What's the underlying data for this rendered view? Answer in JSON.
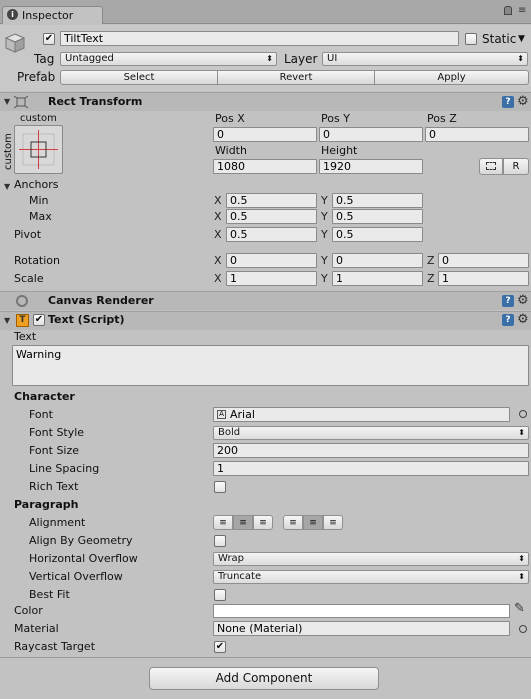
{
  "window": {
    "tab_title": "Inspector",
    "tab_icon": "info-icon",
    "lock_icon": "lock-icon",
    "menu_icon": "menu-icon"
  },
  "gameobject": {
    "active": true,
    "name": "TiltText",
    "static_label": "Static",
    "static_checked": false,
    "tag_label": "Tag",
    "tag_value": "Untagged",
    "layer_label": "Layer",
    "layer_value": "UI",
    "prefab_label": "Prefab",
    "prefab_buttons": [
      "Select",
      "Revert",
      "Apply"
    ]
  },
  "rect_transform": {
    "title": "Rect Transform",
    "anchor_preset_top": "custom",
    "anchor_preset_side": "custom",
    "pos_labels": [
      "Pos X",
      "Pos Y",
      "Pos Z"
    ],
    "pos_values": [
      "0",
      "0",
      "0"
    ],
    "width_label": "Width",
    "height_label": "Height",
    "width_value": "1080",
    "height_value": "1920",
    "raw_button": "R",
    "anchors_label": "Anchors",
    "min_label": "Min",
    "max_label": "Max",
    "min_x": "0.5",
    "min_y": "0.5",
    "max_x": "0.5",
    "max_y": "0.5",
    "pivot_label": "Pivot",
    "pivot_x": "0.5",
    "pivot_y": "0.5",
    "rotation_label": "Rotation",
    "rotation": [
      "0",
      "0",
      "0"
    ],
    "scale_label": "Scale",
    "scale": [
      "1",
      "1",
      "1"
    ],
    "axis_x": "X",
    "axis_y": "Y",
    "axis_z": "Z"
  },
  "canvas_renderer": {
    "title": "Canvas Renderer"
  },
  "text_script": {
    "title": "Text (Script)",
    "enabled": true,
    "text_label": "Text",
    "text_value": "Warning",
    "character_header": "Character",
    "font_label": "Font",
    "font_value": "Arial",
    "font_style_label": "Font Style",
    "font_style_value": "Bold",
    "font_size_label": "Font Size",
    "font_size_value": "200",
    "line_spacing_label": "Line Spacing",
    "line_spacing_value": "1",
    "rich_text_label": "Rich Text",
    "rich_text_checked": false,
    "paragraph_header": "Paragraph",
    "alignment_label": "Alignment",
    "align_geometry_label": "Align By Geometry",
    "h_overflow_label": "Horizontal Overflow",
    "h_overflow_value": "Wrap",
    "v_overflow_label": "Vertical Overflow",
    "v_overflow_value": "Truncate",
    "best_fit_label": "Best Fit",
    "color_label": "Color",
    "color_value": "#ffffff",
    "material_label": "Material",
    "material_value": "None (Material)",
    "raycast_label": "Raycast Target",
    "raycast_checked": true
  },
  "add_component": "Add Component"
}
